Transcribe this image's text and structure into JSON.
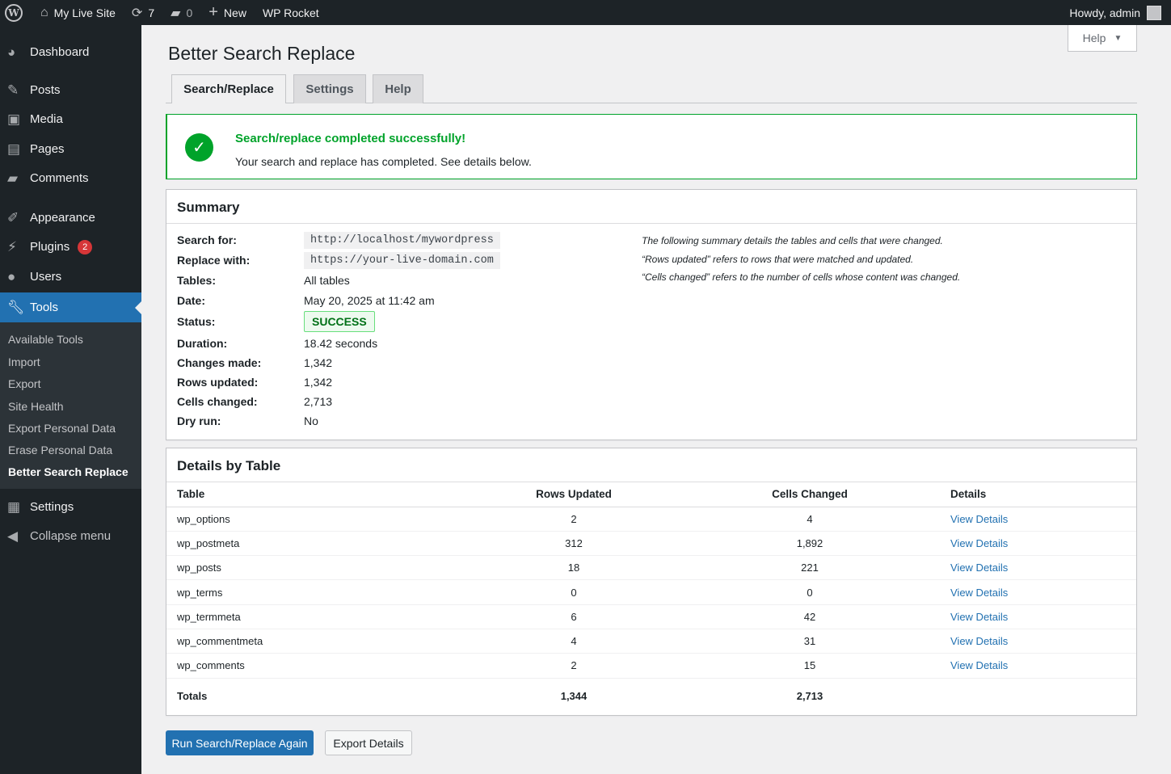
{
  "adminbar": {
    "site_name": "My Live Site",
    "updates_count": "7",
    "comments_count": "0",
    "new_label": "New",
    "plugin_label": "WP Rocket",
    "howdy": "Howdy, admin"
  },
  "sidebar": {
    "items": [
      {
        "label": "Dashboard",
        "icon": "dashboard-icon"
      },
      {
        "label": "Posts",
        "icon": "pin-icon"
      },
      {
        "label": "Media",
        "icon": "media-icon"
      },
      {
        "label": "Pages",
        "icon": "pages-icon"
      },
      {
        "label": "Comments",
        "icon": "comment-icon"
      },
      {
        "label": "Appearance",
        "icon": "brush-icon"
      },
      {
        "label": "Plugins",
        "icon": "plug-icon",
        "badge": "2"
      },
      {
        "label": "Users",
        "icon": "user-icon"
      },
      {
        "label": "Tools",
        "icon": "wrench-icon"
      },
      {
        "label": "Settings",
        "icon": "settings-icon"
      },
      {
        "label": "Collapse menu",
        "icon": "collapse-icon"
      }
    ],
    "submenu": [
      "Available Tools",
      "Import",
      "Export",
      "Site Health",
      "Export Personal Data",
      "Erase Personal Data",
      "Better Search Replace"
    ]
  },
  "page": {
    "title": "Better Search Replace",
    "help_label": "Help",
    "tabs": [
      "Search/Replace",
      "Settings",
      "Help"
    ]
  },
  "notice": {
    "title": "Search/replace completed successfully!",
    "text": "Your search and replace has completed. See details below."
  },
  "summary": {
    "title": "Summary",
    "labels": {
      "search_for": "Search for:",
      "replace_with": "Replace with:",
      "tables": "Tables:",
      "date": "Date:",
      "status": "Status:",
      "duration": "Duration:",
      "changes_made": "Changes made:",
      "rows_updated": "Rows updated:",
      "cells_changed": "Cells changed:",
      "dry_run": "Dry run:"
    },
    "values": {
      "search_for": "http://localhost/mywordpress",
      "replace_with": "https://your-live-domain.com",
      "tables": "All tables",
      "date": "May 20, 2025 at 11:42 am",
      "status": "SUCCESS",
      "duration": "18.42 seconds",
      "changes_made": "1,342",
      "rows_updated": "1,342",
      "cells_changed": "2,713",
      "dry_run": "No"
    },
    "notes": [
      "The following summary details the tables and cells that were changed.",
      "“Rows updated” refers to rows that were matched and updated.",
      "“Cells changed” refers to the number of cells whose content was changed."
    ]
  },
  "details": {
    "title": "Details by Table",
    "columns": [
      "Table",
      "Rows Updated",
      "Cells Changed",
      "Details"
    ],
    "rows": [
      {
        "table": "wp_options",
        "rows": "2",
        "cells": "4",
        "link": "View Details"
      },
      {
        "table": "wp_postmeta",
        "rows": "312",
        "cells": "1,892",
        "link": "View Details"
      },
      {
        "table": "wp_posts",
        "rows": "18",
        "cells": "221",
        "link": "View Details"
      },
      {
        "table": "wp_terms",
        "rows": "0",
        "cells": "0",
        "link": "View Details"
      },
      {
        "table": "wp_termmeta",
        "rows": "6",
        "cells": "42",
        "link": "View Details"
      },
      {
        "table": "wp_commentmeta",
        "rows": "4",
        "cells": "31",
        "link": "View Details"
      },
      {
        "table": "wp_comments",
        "rows": "2",
        "cells": "15",
        "link": "View Details"
      }
    ],
    "totals": {
      "label": "Totals",
      "rows": "1,344",
      "cells": "2,713"
    }
  },
  "actions": {
    "run_again": "Run Search/Replace Again",
    "export": "Export Details"
  },
  "colors": {
    "adminbar_bg": "#1d2327",
    "accent": "#2271b1",
    "success": "#00a32a",
    "badge": "#d63638"
  }
}
